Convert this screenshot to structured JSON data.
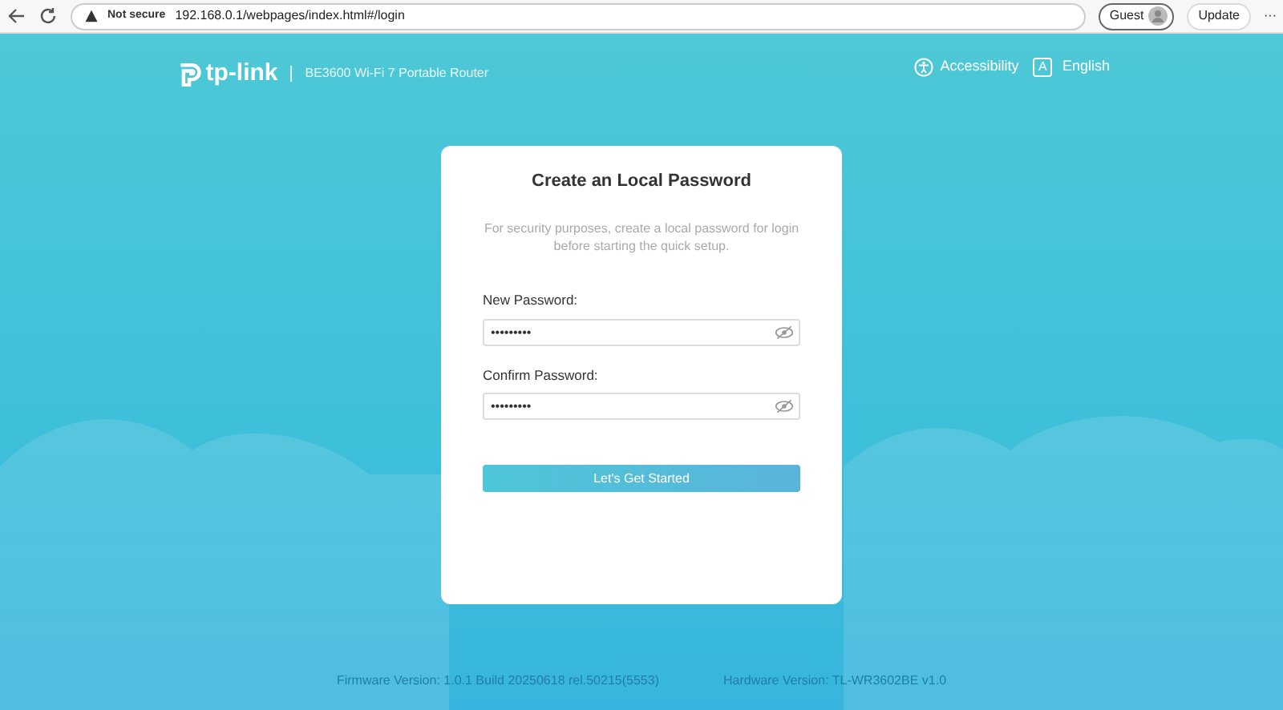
{
  "browser": {
    "security": "Not secure",
    "url": "192.168.0.1/webpages/index.html#/login",
    "profile": "Guest",
    "update": "Update",
    "more": "···"
  },
  "header": {
    "brand": "tp-link",
    "product": "BE3600 Wi-Fi 7 Portable Router",
    "accessibility": "Accessibility",
    "language_icon": "A",
    "language": "English"
  },
  "card": {
    "title": "Create an Local Password",
    "description": "For security purposes, create a local password for login before starting the quick setup.",
    "fields": [
      {
        "label": "New Password:",
        "value": "•••••••••"
      },
      {
        "label": "Confirm Password:",
        "value": "•••••••••"
      }
    ],
    "button": "Let's Get Started"
  },
  "footer": {
    "firmware": "Firmware Version: 1.0.1 Build 20250618 rel.50215(5553)",
    "hardware": "Hardware Version: TL-WR3602BE v1.0"
  }
}
